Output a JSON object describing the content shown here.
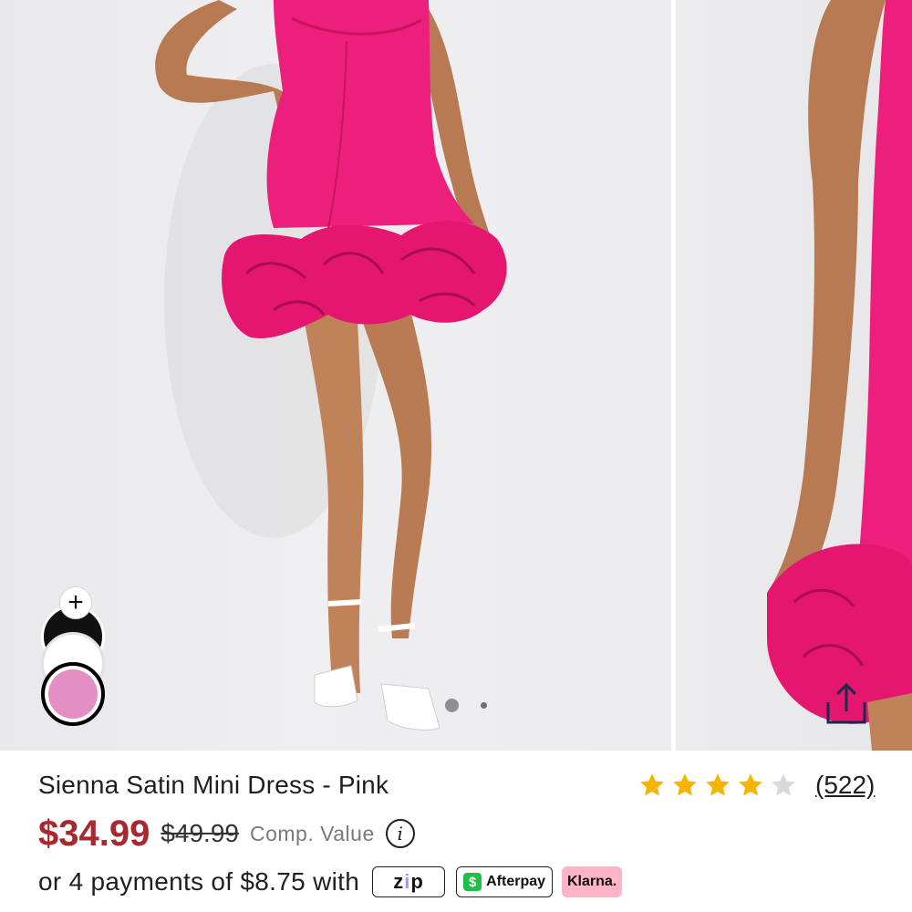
{
  "gallery": {
    "images": [
      "product-photo-front",
      "product-photo-side"
    ],
    "pager": {
      "total": 2,
      "active": 1
    }
  },
  "swatches": {
    "add_icon": "plus-icon",
    "colors": [
      {
        "name": "black",
        "hex": "#111111"
      },
      {
        "name": "white",
        "hex": "#ffffff"
      },
      {
        "name": "pink",
        "hex": "#e48fc4",
        "selected": true
      }
    ]
  },
  "product": {
    "title": "Sienna Satin Mini Dress - Pink",
    "rating": {
      "value": 4,
      "max": 5,
      "count_label": "(522)"
    },
    "price": "$34.99",
    "original_price": "$49.99",
    "comp_label": "Comp. Value",
    "info_glyph": "i",
    "installments_text": "or 4 payments of $8.75 with",
    "payment_badges": {
      "zip": {
        "pre": "z",
        "mid": "i",
        "post": "p"
      },
      "afterpay": "Afterpay",
      "afterpay_icon_glyph": "$",
      "klarna": "Klarna."
    }
  },
  "colors": {
    "accent_price": "#a7282e",
    "dress_pink": "#ec1f7d",
    "star_filled": "#f5b400",
    "star_empty": "#d9d9de"
  }
}
